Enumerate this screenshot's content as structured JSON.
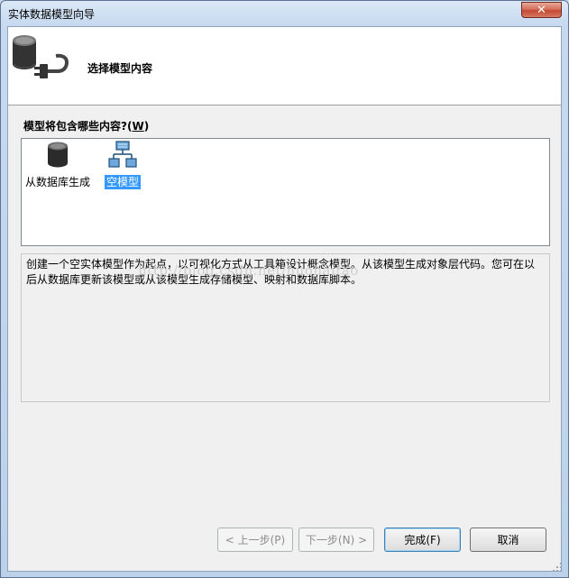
{
  "window": {
    "title": "实体数据模型向导",
    "close_label": "✕"
  },
  "header": {
    "title": "选择模型内容",
    "icon": "database-plug-icon"
  },
  "question": {
    "label": "模型将包含哪些内容?(",
    "accel": "W",
    "suffix": ")"
  },
  "options": [
    {
      "label": "从数据库生成",
      "icon": "database-icon",
      "selected": false
    },
    {
      "label": "空模型",
      "icon": "empty-model-icon",
      "selected": true
    }
  ],
  "description": "创建一个空实体模型作为起点，以可视化方式从工具箱设计概念模型。从该模型生成对象层代码。您可在以后从数据库更新该模型或从该模型生成存储模型、映射和数据库脚本。",
  "watermark": "http://blog.csdn.net/huohaitao",
  "buttons": {
    "prev": "< 上一步(P)",
    "next": "下一步(N) >",
    "finish": "完成(F)",
    "cancel": "取消"
  },
  "colors": {
    "selection": "#3399ff",
    "close_button": "#c24a35"
  }
}
